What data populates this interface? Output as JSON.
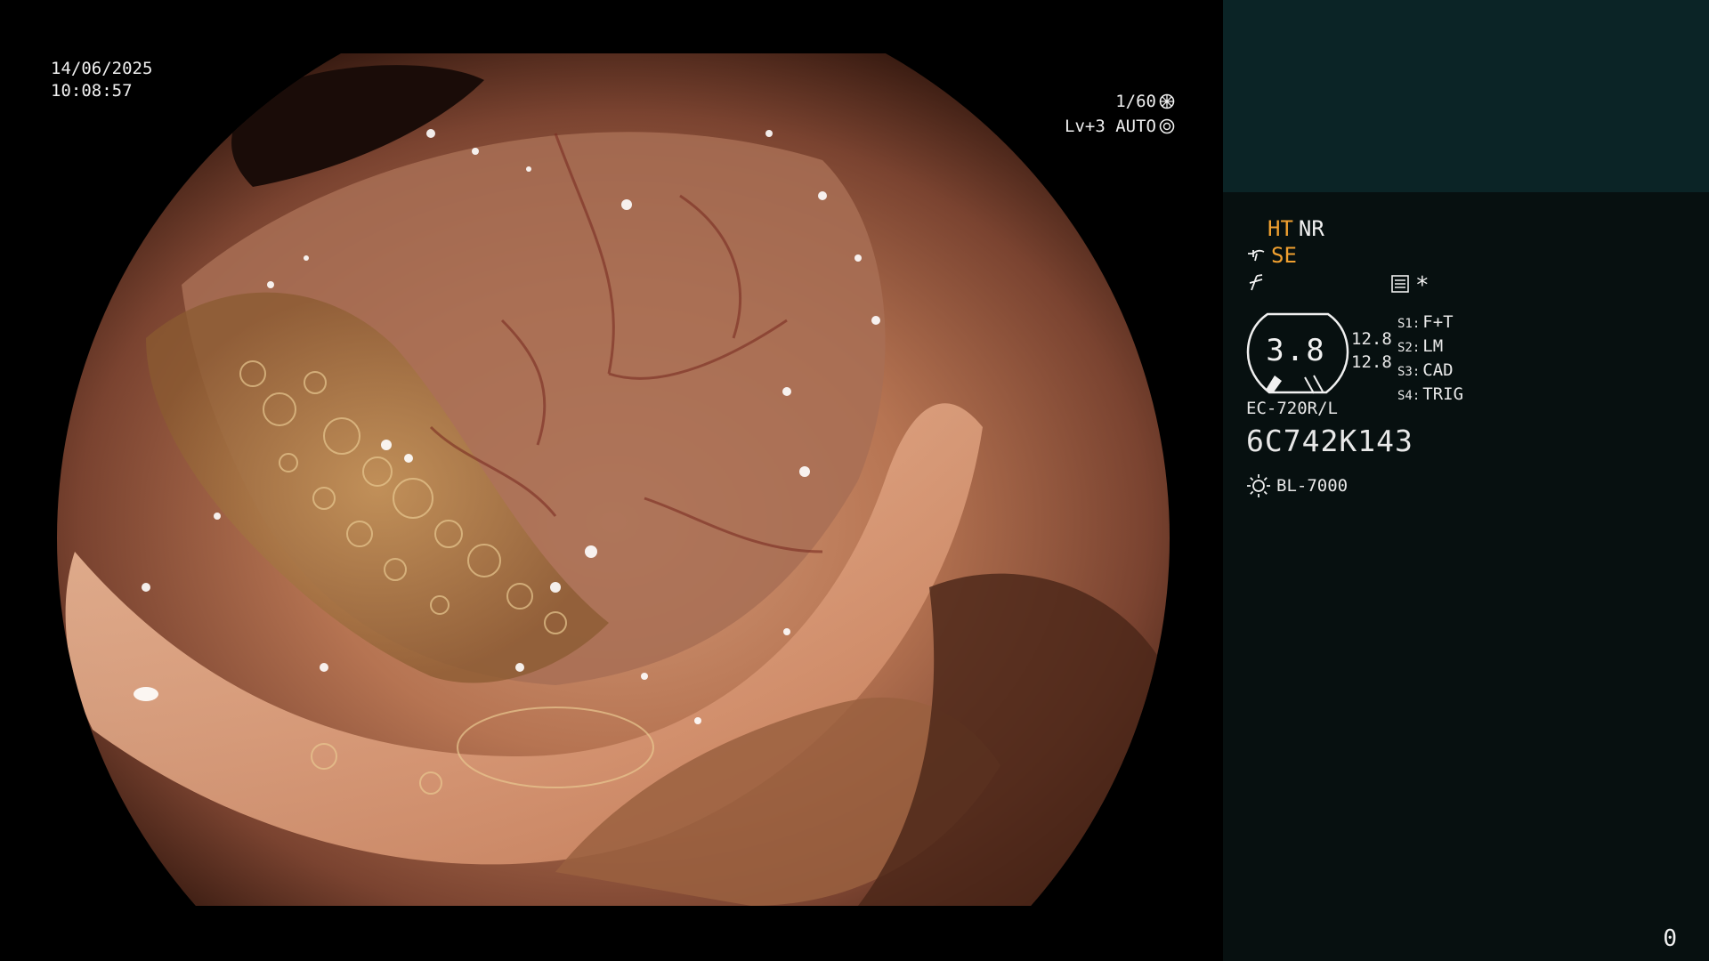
{
  "overlay": {
    "date": "14/06/2025",
    "time": "10:08:57",
    "shutter": "1/60",
    "level": "Lv+3 AUTO"
  },
  "panel": {
    "mode_ht": "HT",
    "mode_nr": "NR",
    "mode_se": "SE",
    "asterisk": "*",
    "gauge_value": "3.8",
    "gauge_top": "12.8",
    "gauge_bottom": "12.8",
    "switches": [
      {
        "key": "S1:",
        "value": "F+T"
      },
      {
        "key": "S2:",
        "value": "LM"
      },
      {
        "key": "S3:",
        "value": "CAD"
      },
      {
        "key": "S4:",
        "value": "TRIG"
      }
    ],
    "scope_model": "EC-720R/L",
    "serial": "6C742K143",
    "light_source": "BL-7000",
    "counter": "0"
  },
  "icons": [
    "shutter-icon",
    "iris-icon",
    "enhance-icon",
    "flicker-icon",
    "memory-icon",
    "gauge-icon",
    "lamp-icon"
  ],
  "colors": {
    "accent_orange": "#f0a030",
    "panel_top": "#0b2426",
    "panel_bg": "#071010"
  }
}
